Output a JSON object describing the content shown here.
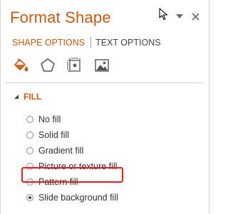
{
  "panel": {
    "title": "Format Shape",
    "accent_color": "#c55a11"
  },
  "tabs": [
    {
      "label": "SHAPE OPTIONS",
      "active": true
    },
    {
      "label": "TEXT OPTIONS",
      "active": false
    }
  ],
  "category_icons": [
    {
      "name": "fill-line-icon",
      "active": true
    },
    {
      "name": "effects-icon",
      "active": false
    },
    {
      "name": "size-properties-icon",
      "active": false
    },
    {
      "name": "picture-icon",
      "active": false
    }
  ],
  "section": {
    "title": "FILL",
    "expanded": true
  },
  "fill_options": [
    {
      "label": "No fill",
      "selected": false
    },
    {
      "label": "Solid fill",
      "selected": false
    },
    {
      "label": "Gradient fill",
      "selected": false
    },
    {
      "label": "Picture or texture fill",
      "selected": false
    },
    {
      "label": "Pattern fill",
      "selected": false
    },
    {
      "label": "Slide background fill",
      "selected": true
    }
  ],
  "highlight_color": "#e0201b"
}
